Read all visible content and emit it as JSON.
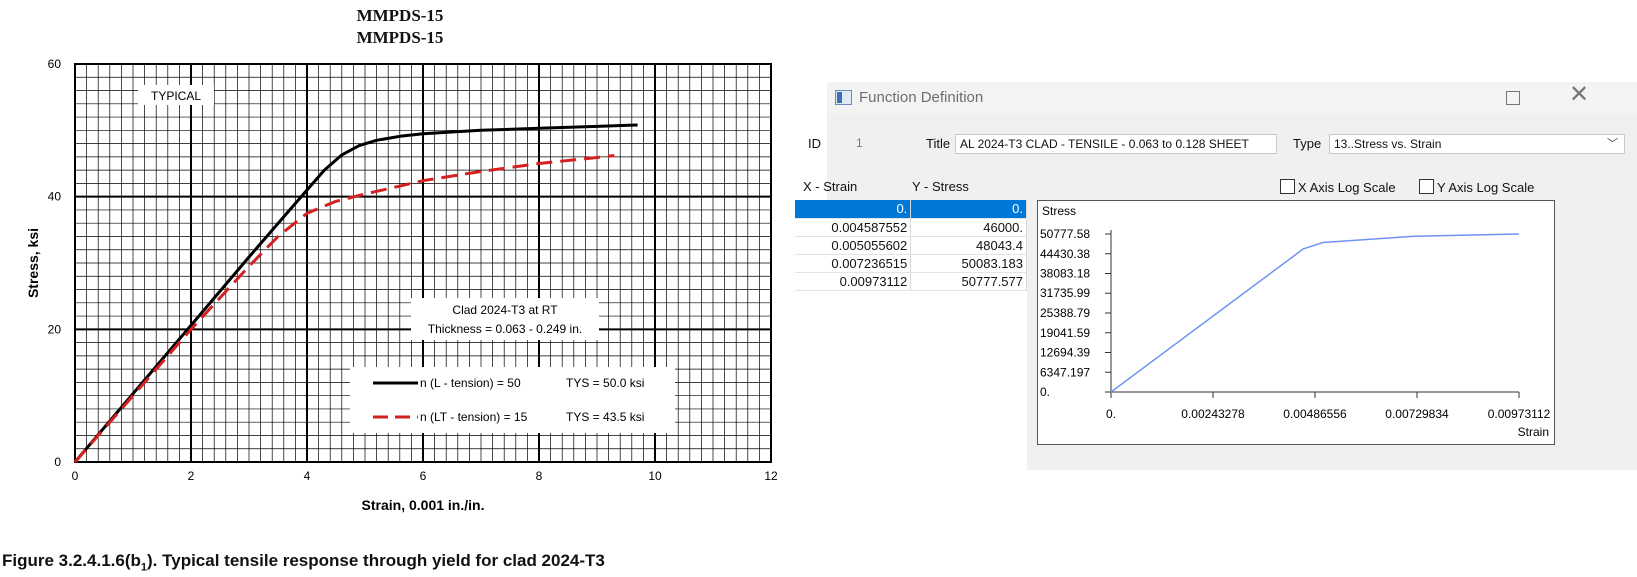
{
  "figure": {
    "header_line1": "MMPDS-15",
    "header_line2": "MMPDS-15",
    "caption_main": "Figure 3.2.4.1.6(b",
    "caption_sub": "1",
    "caption_rest": ").  Typical tensile response through yield for clad 2024-T3"
  },
  "chart_data": [
    {
      "type": "line",
      "xlabel": "Strain, 0.001 in./in.",
      "ylabel": "Stress, ksi",
      "xlim": [
        0,
        12
      ],
      "ylim": [
        0,
        60
      ],
      "x_ticks": [
        "0",
        "2",
        "4",
        "6",
        "8",
        "10",
        "12"
      ],
      "y_ticks": [
        "0",
        "20",
        "40",
        "60"
      ],
      "grid": true,
      "annotations": [
        "TYPICAL",
        "Clad 2024-T3 at RT",
        "Thickness = 0.063 - 0.249 in."
      ],
      "legend": [
        {
          "label": "n (L - tension) = 50",
          "tys": "TYS = 50.0 ksi",
          "style": "solid",
          "color": "#000000"
        },
        {
          "label": "n (LT - tension) = 15",
          "tys": "TYS = 43.5 ksi",
          "style": "dashed",
          "color": "#d42020"
        }
      ],
      "series": [
        {
          "x": [
            0,
            1,
            2,
            3,
            4,
            4.3,
            4.6,
            4.9,
            5.2,
            5.6,
            6,
            7,
            8,
            9,
            9.7
          ],
          "y": [
            0,
            10.3,
            20.6,
            30.9,
            41,
            44,
            46.3,
            47.7,
            48.5,
            49.1,
            49.5,
            50,
            50.3,
            50.6,
            50.8
          ]
        },
        {
          "x": [
            0,
            1,
            2,
            3,
            3.5,
            4,
            4.5,
            5,
            5.5,
            6,
            7,
            8,
            9,
            9.3
          ],
          "y": [
            0,
            10,
            20,
            29.5,
            34,
            37.5,
            39.3,
            40.4,
            41.4,
            42.4,
            43.8,
            45,
            45.9,
            46.2
          ]
        }
      ]
    },
    {
      "type": "line",
      "title": "Stress",
      "xlabel": "Strain",
      "xlim": [
        0,
        0.00973112
      ],
      "ylim": [
        0,
        50777.58
      ],
      "x_ticks": [
        "0.",
        "0.00243278",
        "0.00486556",
        "0.00729834",
        "0.00973112"
      ],
      "y_ticks": [
        "0.",
        "6347.197",
        "12694.39",
        "19041.59",
        "25388.79",
        "31735.99",
        "38083.18",
        "44430.38",
        "50777.58"
      ],
      "series": [
        {
          "color": "#6f95f2",
          "x": [
            0,
            0.004587552,
            0.005055602,
            0.007236515,
            0.00973112
          ],
          "y": [
            0,
            46000,
            48043.4,
            50083.183,
            50777.577
          ]
        }
      ]
    }
  ],
  "dialog": {
    "window_title": "Function Definition",
    "id_label": "ID",
    "id_value": "1",
    "title_label": "Title",
    "title_value": "AL 2024-T3 CLAD - TENSILE - 0.063 to 0.128 SHEET",
    "type_label": "Type",
    "type_value": "13..Stress vs. Strain",
    "x_col_header": "X - Strain",
    "y_col_header": "Y - Stress",
    "x_log_label": "X Axis Log Scale",
    "y_log_label": "Y Axis Log Scale",
    "rows": [
      [
        "0.",
        "0."
      ],
      [
        "0.004587552",
        "46000."
      ],
      [
        "0.005055602",
        "48043.4"
      ],
      [
        "0.007236515",
        "50083.183"
      ],
      [
        "0.00973112",
        "50777.577"
      ]
    ]
  }
}
